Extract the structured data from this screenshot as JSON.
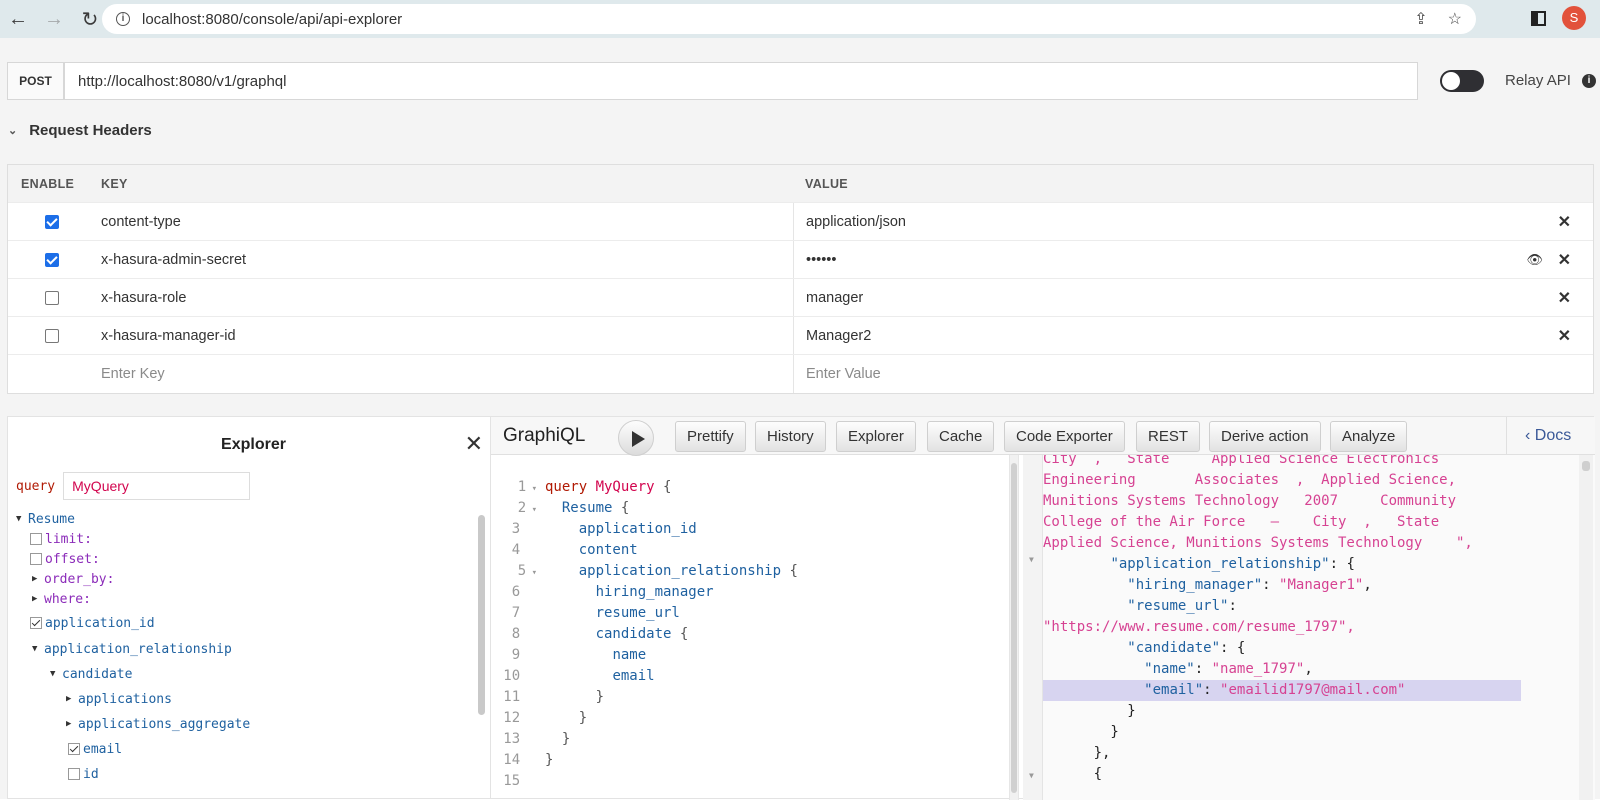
{
  "browser": {
    "url": "localhost:8080/console/api/api-explorer",
    "avatar_letter": "S"
  },
  "endpoint": {
    "method": "POST",
    "url": "http://localhost:8080/v1/graphql",
    "relay_label": "Relay API",
    "relay_enabled": false
  },
  "request_headers": {
    "title": "Request Headers",
    "columns": [
      "ENABLE",
      "KEY",
      "VALUE"
    ],
    "rows": [
      {
        "enabled": true,
        "key": "content-type",
        "value": "application/json"
      },
      {
        "enabled": true,
        "key": "x-hasura-admin-secret",
        "value": "••••••"
      },
      {
        "enabled": false,
        "key": "x-hasura-role",
        "value": "manager"
      },
      {
        "enabled": false,
        "key": "x-hasura-manager-id",
        "value": "Manager2"
      }
    ],
    "key_placeholder": "Enter Key",
    "value_placeholder": "Enter Value"
  },
  "explorer": {
    "title": "Explorer",
    "query_keyword": "query",
    "query_name": "MyQuery",
    "tree": {
      "root": "Resume",
      "limit": "limit:",
      "offset": "offset:",
      "order_by": "order_by:",
      "where": "where:",
      "application_id": "application_id",
      "application_relationship": "application_relationship",
      "candidate": "candidate",
      "applications": "applications",
      "applications_aggregate": "applications_aggregate",
      "email": "email",
      "id": "id"
    }
  },
  "graphiql": {
    "title": "GraphiQL",
    "toolbar": [
      "Prettify",
      "History",
      "Explorer",
      "Cache",
      "Code Exporter",
      "REST",
      "Derive action",
      "Analyze"
    ],
    "docs_label": "Docs",
    "query_lines": [
      "query MyQuery {",
      "  Resume {",
      "    application_id",
      "    content",
      "    application_relationship {",
      "      hiring_manager",
      "      resume_url",
      "      candidate {",
      "        name",
      "        email",
      "      }",
      "    }",
      "  }",
      "}",
      ""
    ],
    "result_lines": [
      "City  ,   State     Applied Science Electronics",
      "Engineering       Associates  ,  Applied Science,",
      "Munitions Systems Technology   2007     Community",
      "College of the Air Force   –    City  ,   State",
      "Applied Science, Munitions Systems Technology    \",",
      "        \"application_relationship\": {",
      "          \"hiring_manager\": \"Manager1\",",
      "          \"resume_url\":",
      "\"https://www.resume.com/resume_1797\",",
      "          \"candidate\": {",
      "            \"name\": \"name_1797\",",
      "            \"email\": \"emailid1797@mail.com\"",
      "          }",
      "        }",
      "      },",
      "      {"
    ]
  }
}
